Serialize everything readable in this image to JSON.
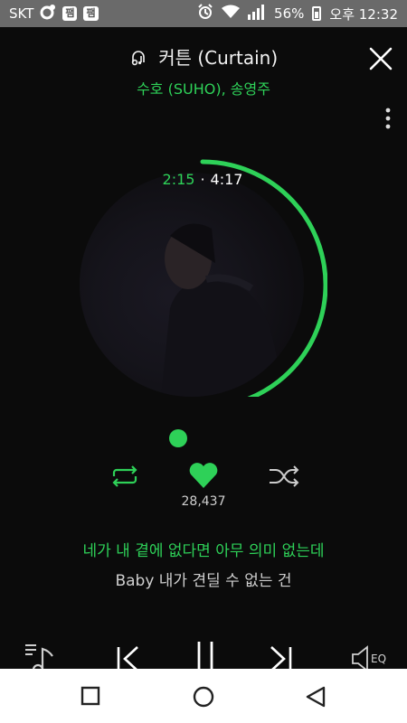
{
  "status_bar": {
    "carrier": "SKT",
    "app_badges": [
      "팸",
      "팸"
    ],
    "battery_percent": "56%",
    "time": "오후 12:32",
    "icons": [
      "music-icon",
      "alarm-icon",
      "wifi-icon",
      "signal-icon",
      "battery-icon"
    ]
  },
  "track": {
    "title": "커튼 (Curtain)",
    "artist": "수호 (SUHO), 송영주",
    "current_time": "2:15",
    "separator": "·",
    "total_time": "4:17",
    "progress_fraction": 0.525,
    "likes": "28,437"
  },
  "lyrics": {
    "current": "네가 내 곁에 없다면 아무 의미 없는데",
    "next": "Baby 내가 견딜 수 없는 건"
  },
  "colors": {
    "accent": "#2ed158",
    "background": "#0b0b0b",
    "status_bar": "#6a6a6a"
  },
  "controls": {
    "eq_label": "EQ"
  }
}
